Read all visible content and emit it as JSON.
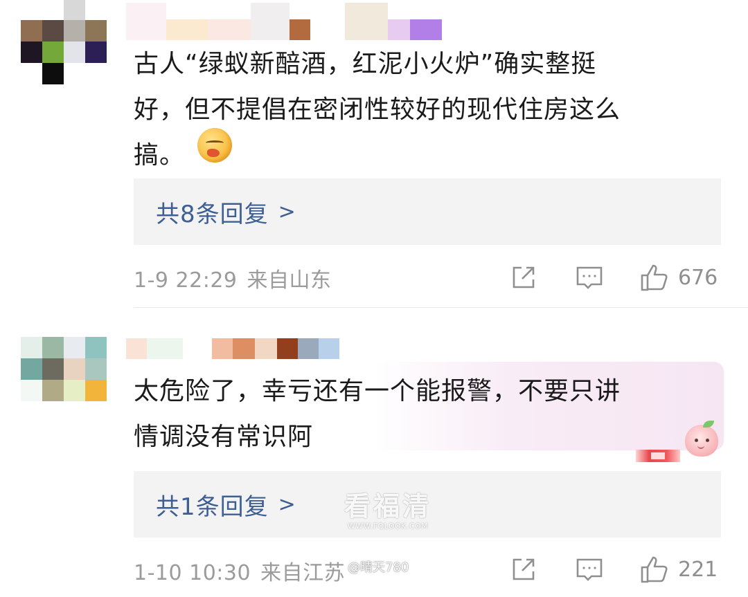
{
  "comments": [
    {
      "text_lines": [
        "古人“绿蚁新醅酒，红泥小火炉”确实整挺",
        "好，但不提倡在密闭性较好的现代住房这么",
        "搞。"
      ],
      "replies_label": "共8条回复",
      "replies_chevron": ">",
      "time": "1-9 22:29",
      "location": "来自山东",
      "like_count": "676",
      "avatar_colors": [
        "#ffffff",
        "#ffffff",
        "#d8d8d8",
        "#ffffff",
        "#8f6e52",
        "#5b4a43",
        "#b5b0aa",
        "#8d7557",
        "#1e1623",
        "#74a83a",
        "#e3e4ea",
        "#2b1f55",
        "#ffffff",
        "#0d0d0d",
        "#ffffff",
        "#ffffff"
      ],
      "username_colors": [
        "#fbf0f3",
        "#fcead0",
        "#fbe8e3",
        "#f1eeef",
        "#b26a3f",
        "#ffffff",
        "#f0e9dc",
        "#e7cbf0",
        "#b27fe9"
      ]
    },
    {
      "text_lines": [
        "太危险了，幸亏还有一个能报警，不要只讲",
        "情调没有常识阿"
      ],
      "replies_label": "共1条回复",
      "replies_chevron": ">",
      "time": "1-10 10:30",
      "location": "来自江苏",
      "like_count": "221",
      "avatar_colors": [
        "#e3efe8",
        "#9ab8a4",
        "#e8ecf0",
        "#8fc3c0",
        "#74a7a0",
        "#6d6b60",
        "#e7d3c0",
        "#a9c7bf",
        "#f4f8f5",
        "#b0aa86",
        "#e6eec5",
        "#f2b43b"
      ],
      "username_colors": [
        "#fbe2d6",
        "#ecf6ec",
        "#ffffff",
        "#f1bca0",
        "#dd8f63",
        "#f2d7c4",
        "#933f1d",
        "#9aa9bb",
        "#b9d0ea"
      ]
    }
  ],
  "watermark": {
    "main": "看福清",
    "url": "WWW.FQLOOK.COM"
  },
  "handle": "@晴天780",
  "colors": {
    "link": "#3e5f94",
    "meta": "#9b9b9b",
    "reply_bg": "#f3f3f3"
  }
}
